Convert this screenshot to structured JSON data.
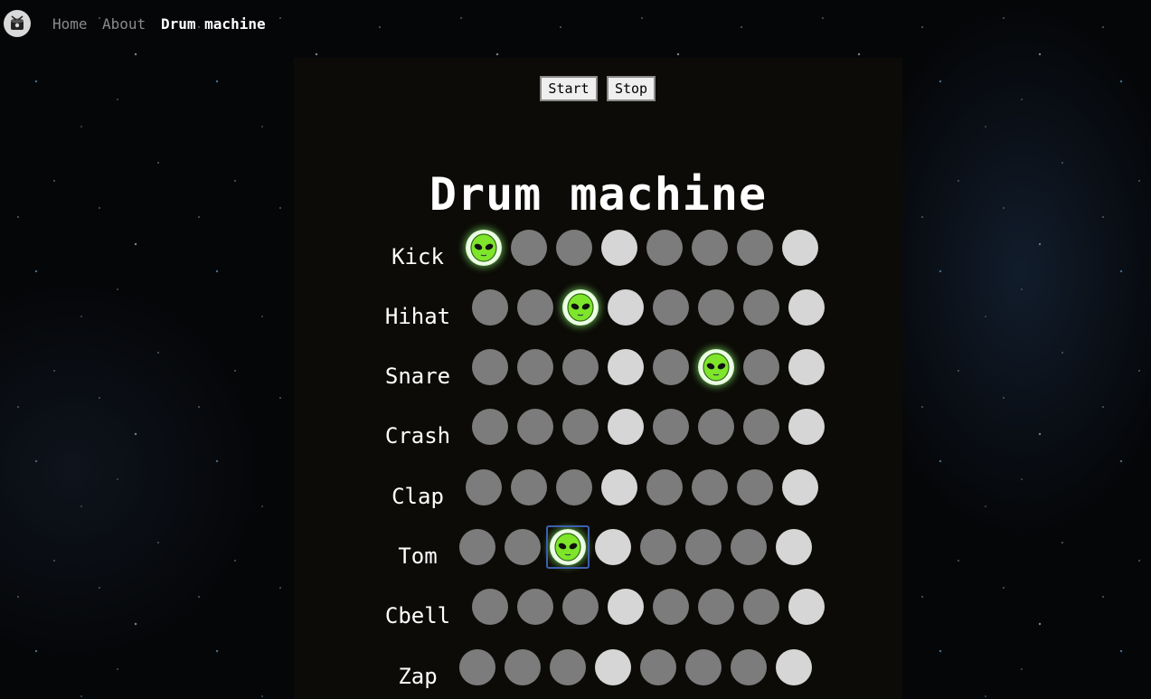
{
  "nav": {
    "logo_icon": "drum-logo-icon",
    "links": [
      "Home",
      "About",
      "Drum machine"
    ],
    "current_index": 2
  },
  "controls": {
    "start_label": "Start",
    "stop_label": "Stop"
  },
  "title": "Drum machine",
  "colors": {
    "pad_dark": "#7c7c7c",
    "pad_light": "#d6d6d6",
    "active_glow": "#8cff6e",
    "panel_bg": "#0c0b07",
    "focus_outline": "#3d5fb0"
  },
  "pad_icon": "alien-face-icon",
  "rows": [
    {
      "label": "Kick",
      "steps": [
        1,
        0,
        0,
        0,
        0,
        0,
        0,
        0
      ]
    },
    {
      "label": "Hihat",
      "steps": [
        0,
        0,
        1,
        0,
        0,
        0,
        0,
        0
      ]
    },
    {
      "label": "Snare",
      "steps": [
        0,
        0,
        0,
        0,
        0,
        1,
        0,
        0
      ]
    },
    {
      "label": "Crash",
      "steps": [
        0,
        0,
        0,
        0,
        0,
        0,
        0,
        0
      ]
    },
    {
      "label": "Clap",
      "steps": [
        0,
        0,
        0,
        0,
        0,
        0,
        0,
        0
      ]
    },
    {
      "label": "Tom",
      "steps": [
        0,
        0,
        1,
        0,
        0,
        0,
        0,
        0
      ]
    },
    {
      "label": "Cbell",
      "steps": [
        0,
        0,
        0,
        0,
        0,
        0,
        0,
        0
      ]
    },
    {
      "label": "Zap",
      "steps": [
        0,
        0,
        0,
        0,
        0,
        0,
        0,
        0
      ]
    }
  ],
  "light_steps": [
    4,
    8
  ],
  "focused": {
    "row": 5,
    "step": 2
  }
}
